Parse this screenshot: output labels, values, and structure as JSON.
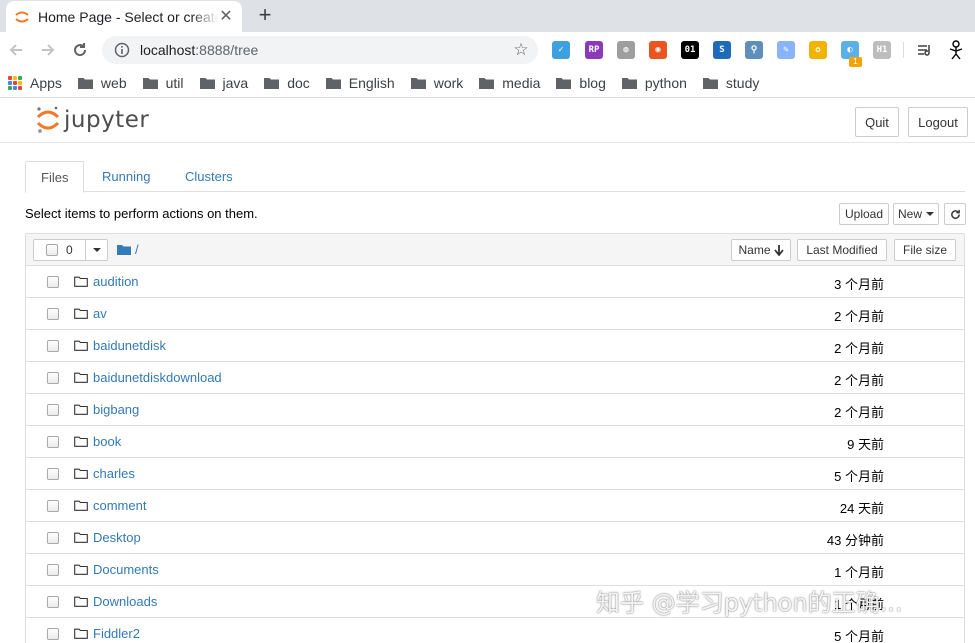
{
  "browser": {
    "tab_title": "Home Page - Select or create a notebook",
    "url_host": "localhost",
    "url_rest": ":8888/tree",
    "extensions": [
      {
        "name": "ext-bird",
        "color": "#3fa0e0",
        "text": "✓"
      },
      {
        "name": "ext-rp",
        "color": "#8a3ab9",
        "text": "RP"
      },
      {
        "name": "ext-ghost",
        "color": "#9e9e9e",
        "text": "◍"
      },
      {
        "name": "ext-ubuntu",
        "color": "#e95420",
        "text": "◉"
      },
      {
        "name": "ext-01",
        "color": "#000000",
        "text": "01"
      },
      {
        "name": "ext-s",
        "color": "#1e6bb8",
        "text": "S"
      },
      {
        "name": "ext-search",
        "color": "#5f8fb8",
        "text": "⚲"
      },
      {
        "name": "ext-doc",
        "color": "#8ab4f8",
        "text": "✎"
      },
      {
        "name": "ext-compass",
        "color": "#f0b400",
        "text": "✪"
      },
      {
        "name": "ext-badge",
        "color": "#5bb0e8",
        "text": "◐"
      },
      {
        "name": "ext-h1",
        "color": "#bdbdbd",
        "text": "H1"
      }
    ],
    "badge_count": "1"
  },
  "bookmarks": [
    {
      "label": "Apps",
      "kind": "apps"
    },
    {
      "label": "web",
      "kind": "folder"
    },
    {
      "label": "util",
      "kind": "folder"
    },
    {
      "label": "java",
      "kind": "folder"
    },
    {
      "label": "doc",
      "kind": "folder"
    },
    {
      "label": "English",
      "kind": "folder"
    },
    {
      "label": "work",
      "kind": "folder"
    },
    {
      "label": "media",
      "kind": "folder"
    },
    {
      "label": "blog",
      "kind": "folder"
    },
    {
      "label": "python",
      "kind": "folder"
    },
    {
      "label": "study",
      "kind": "folder"
    }
  ],
  "jupyter": {
    "logo_text": "jupyter",
    "quit_label": "Quit",
    "logout_label": "Logout",
    "tabs": [
      "Files",
      "Running",
      "Clusters"
    ],
    "instructions": "Select items to perform actions on them.",
    "upload_label": "Upload",
    "new_label": "New",
    "selected_count": "0",
    "breadcrumb": "/",
    "col_name": "Name",
    "col_modified": "Last Modified",
    "col_size": "File size"
  },
  "files": [
    {
      "name": "audition",
      "modified": "3 个月前"
    },
    {
      "name": "av",
      "modified": "2 个月前"
    },
    {
      "name": "baidunetdisk",
      "modified": "2 个月前"
    },
    {
      "name": "baidunetdiskdownload",
      "modified": "2 个月前"
    },
    {
      "name": "bigbang",
      "modified": "2 个月前"
    },
    {
      "name": "book",
      "modified": "9 天前"
    },
    {
      "name": "charles",
      "modified": "5 个月前"
    },
    {
      "name": "comment",
      "modified": "24 天前"
    },
    {
      "name": "Desktop",
      "modified": "43 分钟前"
    },
    {
      "name": "Documents",
      "modified": "1 个月前"
    },
    {
      "name": "Downloads",
      "modified": "1 个月前"
    },
    {
      "name": "Fiddler2",
      "modified": "5 个月前"
    }
  ],
  "watermark": "知乎 @学习python的正确..."
}
